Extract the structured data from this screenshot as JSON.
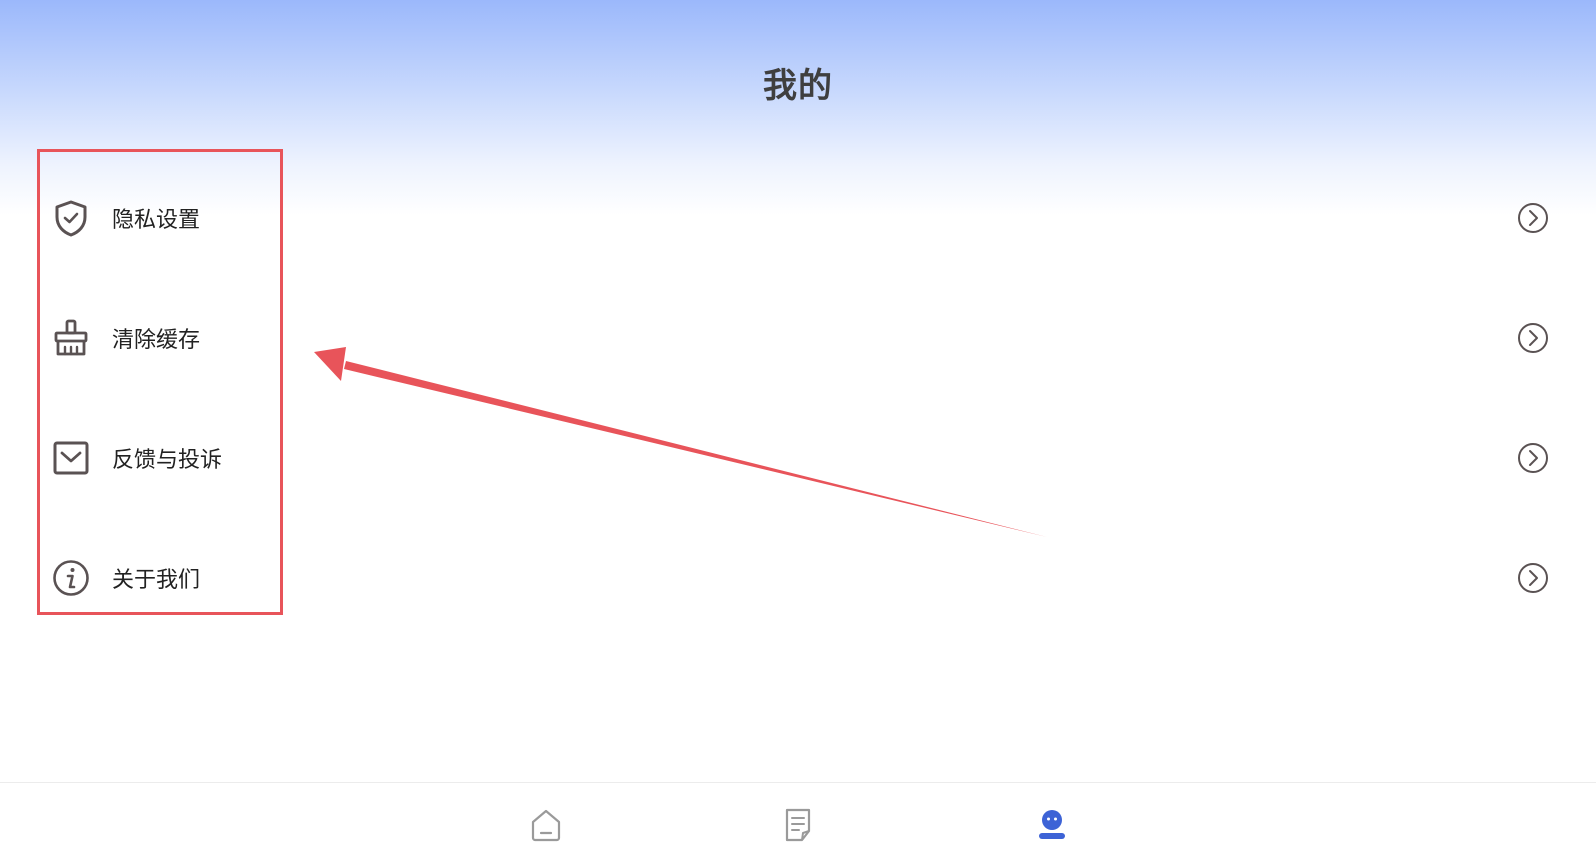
{
  "header": {
    "title": "我的"
  },
  "menu": {
    "items": [
      {
        "label": "隐私设置",
        "icon": "shield-check-icon"
      },
      {
        "label": "清除缓存",
        "icon": "broom-icon"
      },
      {
        "label": "反馈与投诉",
        "icon": "mail-icon"
      },
      {
        "label": "关于我们",
        "icon": "info-icon"
      }
    ]
  },
  "tabbar": {
    "tabs": [
      {
        "icon": "home-icon",
        "active": false
      },
      {
        "icon": "document-icon",
        "active": false
      },
      {
        "icon": "profile-icon",
        "active": true
      }
    ]
  },
  "colors": {
    "accent": "#3d63d6",
    "annotation": "#e8545a",
    "icon": "#5a5253"
  }
}
